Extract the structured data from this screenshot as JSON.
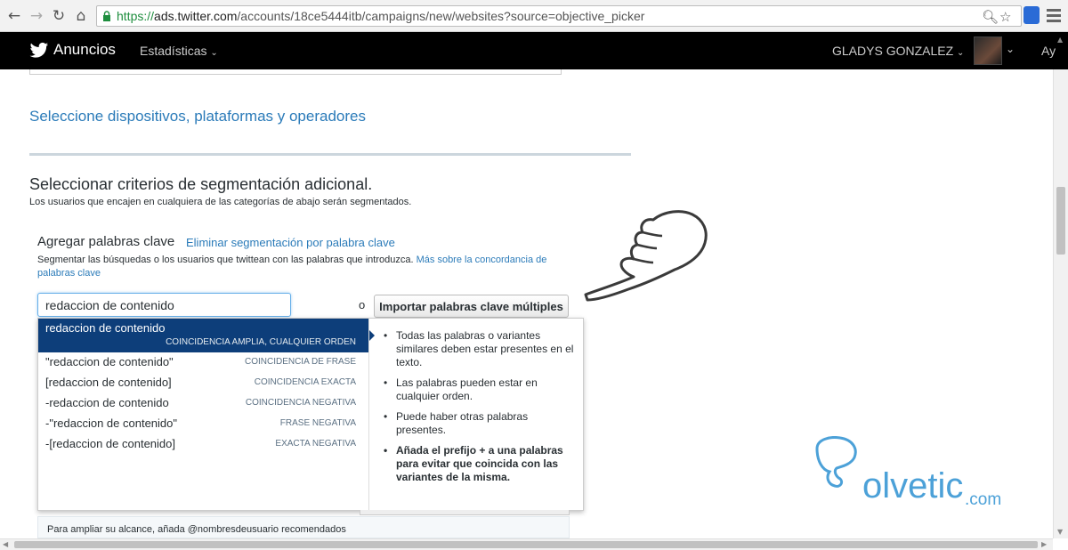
{
  "browser": {
    "url_scheme": "https://",
    "url_host": "ads.twitter.com",
    "url_path": "/accounts/18ce5444itb/campaigns/new/websites?source=objective_picker"
  },
  "topbar": {
    "brand": "Anuncios",
    "nav_stats": "Estadísticas",
    "user_name": "GLADYS GONZALEZ",
    "help": "Ay"
  },
  "devices": {
    "title": "Seleccione dispositivos, plataformas y operadores"
  },
  "targeting": {
    "title": "Seleccionar criterios de segmentación adicional.",
    "subtitle": "Los usuarios que encajen en cualquiera de las categorías de abajo serán segmentados."
  },
  "keywords": {
    "title": "Agregar palabras clave",
    "remove_link": "Eliminar segmentación por palabra clave",
    "description": "Segmentar las búsquedas o los usuarios que twittean con las palabras que introduzca.",
    "more_link": "Más sobre la concordancia de palabras clave",
    "input_value": "redaccion de contenido",
    "or_label": "o",
    "import_button": "Importar palabras clave múltiples"
  },
  "dropdown": {
    "items": [
      {
        "text": "redaccion de contenido",
        "match": "COINCIDENCIA AMPLIA, CUALQUIER ORDEN"
      },
      {
        "text": "\"redaccion de contenido\"",
        "match": "COINCIDENCIA DE FRASE"
      },
      {
        "text": "[redaccion de contenido]",
        "match": "COINCIDENCIA EXACTA"
      },
      {
        "text": "-redaccion de contenido",
        "match": "COINCIDENCIA NEGATIVA"
      },
      {
        "text": "-\"redaccion de contenido\"",
        "match": "FRASE NEGATIVA"
      },
      {
        "text": "-[redaccion de contenido]",
        "match": "EXACTA NEGATIVA"
      }
    ],
    "help": [
      "Todas las palabras o variantes similares deben estar presentes en el texto.",
      "Las palabras pueden estar en cualquier orden.",
      "Puede haber otras palabras presentes.",
      "Añada el prefijo + a una palabras para evitar que coincida con las variantes de la misma."
    ]
  },
  "hint": {
    "text": "Para ampliar su alcance, añada @nombresdeusuario recomendados"
  },
  "watermark": {
    "text": "olvetic",
    "suffix": ".com"
  },
  "colors": {
    "link": "#2b7bb9",
    "topbar": "#000000",
    "dropdown_active": "#0d3e7a",
    "watermark": "#4ca1d8"
  }
}
